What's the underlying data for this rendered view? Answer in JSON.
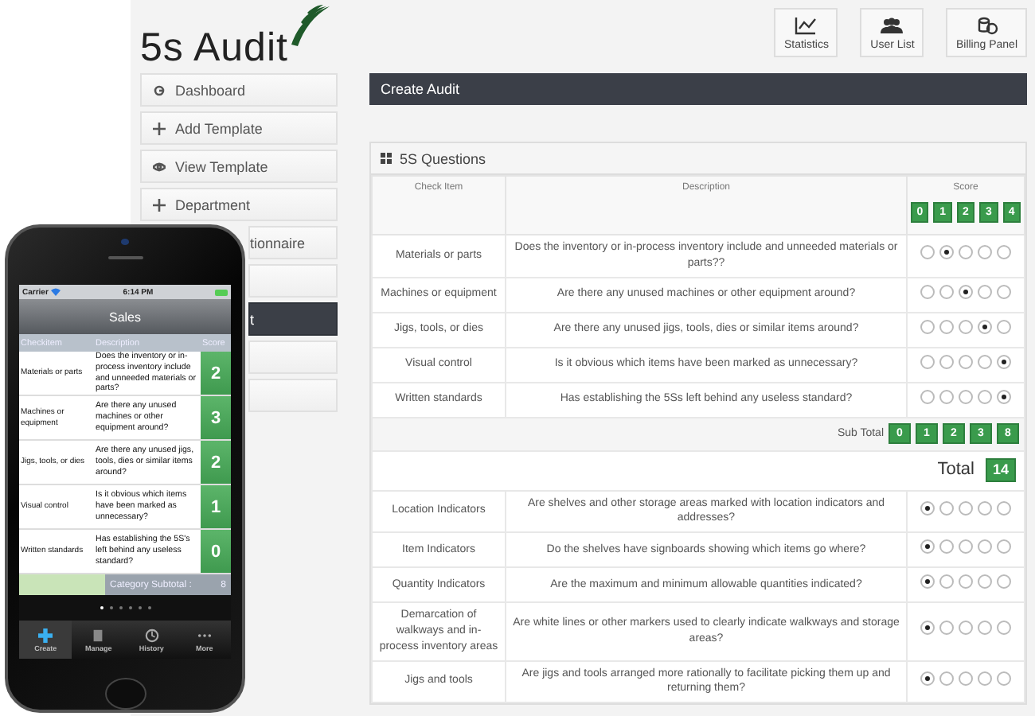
{
  "logo": {
    "text": "5s Audit"
  },
  "header_buttons": [
    {
      "label": "Statistics"
    },
    {
      "label": "User List"
    },
    {
      "label": "Billing Panel"
    }
  ],
  "sidebar": {
    "items": [
      {
        "label": "Dashboard",
        "selected": false,
        "kind": "full"
      },
      {
        "label": "Add Template",
        "selected": false,
        "kind": "full"
      },
      {
        "label": "View Template",
        "selected": false,
        "kind": "full"
      },
      {
        "label": "Department",
        "selected": false,
        "kind": "full"
      },
      {
        "label": "tionnaire",
        "selected": false,
        "kind": "cut"
      },
      {
        "selected": false,
        "kind": "cut"
      },
      {
        "label": "t",
        "selected": true,
        "kind": "cut"
      },
      {
        "selected": false,
        "kind": "cut"
      },
      {
        "selected": false,
        "kind": "cut"
      }
    ]
  },
  "page_title": "Create Audit",
  "questions": {
    "title": "5S Questions",
    "columns": [
      "Check Item",
      "Description",
      "Score"
    ],
    "scores": [
      "0",
      "1",
      "2",
      "3",
      "4"
    ],
    "rows": [
      {
        "item": "Materials or parts",
        "question": "Does the inventory or in-process inventory include and unneeded materials or parts??",
        "options": [
          false,
          true,
          false,
          false,
          false
        ]
      },
      {
        "item": "Machines or equipment",
        "question": "Are there any unused machines or other equipment around?",
        "options": [
          false,
          false,
          true,
          false,
          false
        ]
      },
      {
        "item": "Jigs, tools, or dies",
        "question": "Are there any unused jigs, tools, dies or similar items around?",
        "options": [
          false,
          false,
          false,
          true,
          false
        ]
      },
      {
        "item": "Visual control",
        "question": "Is it obvious which items have been marked as unnecessary?",
        "options": [
          false,
          false,
          false,
          false,
          true
        ]
      },
      {
        "item": "Written standards",
        "question": "Has establishing the 5Ss left behind any useless standard?",
        "options": [
          false,
          false,
          false,
          false,
          true
        ]
      }
    ],
    "subtotal_label": "Sub Total",
    "subtotal": [
      "0",
      "1",
      "2",
      "3",
      "8"
    ],
    "total_label": "Total",
    "total": "14",
    "rows2": [
      {
        "item": "Location Indicators",
        "question": "Are shelves and other storage areas marked with location indicators and addresses?",
        "options": [
          true,
          false,
          false,
          false,
          false
        ]
      },
      {
        "item": "Item Indicators",
        "question": "Do the shelves have signboards showing which items go where?",
        "options": [
          true,
          false,
          false,
          false,
          false
        ]
      },
      {
        "item": "Quantity Indicators",
        "question": "Are the maximum and minimum allowable quantities indicated?",
        "options": [
          true,
          false,
          false,
          false,
          false
        ]
      },
      {
        "item": "Demarcation of walkways and in-process inventory areas",
        "question": "Are white lines or other markers used to clearly indicate walkways and storage areas?",
        "options": [
          true,
          false,
          false,
          false,
          false
        ]
      },
      {
        "item": "Jigs and tools",
        "question": "Are jigs and tools arranged more rationally to facilitate picking them up and returning them?",
        "options": [
          true,
          false,
          false,
          false,
          false
        ]
      }
    ]
  },
  "phone": {
    "carrier": "Carrier",
    "time": "6:14 PM",
    "title": "Sales",
    "columns": [
      "Checkitem",
      "Description",
      "Score"
    ],
    "rows": [
      {
        "item": "Materials or parts",
        "question": "Does the inventory or in-process inventory include and unneeded materials or parts?",
        "score": "2"
      },
      {
        "item": "Machines or equipment",
        "question": "Are there any unused machines or other equipment around?",
        "score": "3"
      },
      {
        "item": "Jigs, tools, or dies",
        "question": "Are there any unused jigs, tools, dies or similar items around?",
        "score": "2"
      },
      {
        "item": "Visual control",
        "question": "Is it obvious which items have been marked as unnecessary?",
        "score": "1"
      },
      {
        "item": "Written standards",
        "question": "Has establishing the 5S's left behind any useless standard?",
        "score": "0"
      }
    ],
    "subtotal_label": "Category Subtotal :",
    "subtotal": "8",
    "page_dots": [
      {
        "selected": true
      },
      {
        "selected": false
      },
      {
        "selected": false
      },
      {
        "selected": false
      },
      {
        "selected": false
      },
      {
        "selected": false
      }
    ],
    "tabs": [
      {
        "label": "Create",
        "selected": true
      },
      {
        "label": "Manage",
        "selected": false
      },
      {
        "label": "History",
        "selected": false
      },
      {
        "label": "More",
        "selected": false
      }
    ]
  }
}
